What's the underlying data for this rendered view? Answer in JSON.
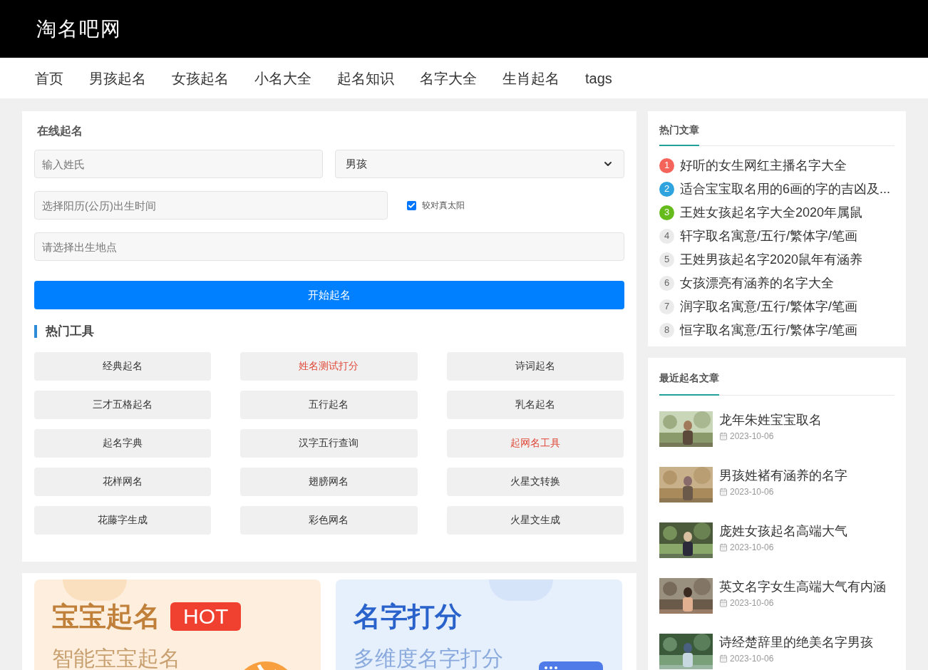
{
  "site": {
    "logo": "淘名吧网"
  },
  "nav": [
    {
      "label": "首页"
    },
    {
      "label": "男孩起名"
    },
    {
      "label": "女孩起名"
    },
    {
      "label": "小名大全"
    },
    {
      "label": "起名知识"
    },
    {
      "label": "名字大全"
    },
    {
      "label": "生肖起名"
    },
    {
      "label": "tags"
    }
  ],
  "form": {
    "title": "在线起名",
    "surname": {
      "placeholder": "输入姓氏"
    },
    "gender": {
      "value": "男孩"
    },
    "birth_time": {
      "placeholder": "选择阳历(公历)出生时间"
    },
    "true_solar": {
      "label": "较对真太阳",
      "checked": true
    },
    "birth_place": {
      "placeholder": "请选择出生地点"
    },
    "submit": "开始起名"
  },
  "tools": {
    "title": "热门工具",
    "items": [
      {
        "label": "经典起名",
        "hot": false
      },
      {
        "label": "姓名测试打分",
        "hot": true
      },
      {
        "label": "诗词起名",
        "hot": false
      },
      {
        "label": "三才五格起名",
        "hot": false
      },
      {
        "label": "五行起名",
        "hot": false
      },
      {
        "label": "乳名起名",
        "hot": false
      },
      {
        "label": "起名字典",
        "hot": false
      },
      {
        "label": "汉字五行查询",
        "hot": false
      },
      {
        "label": "起网名工具",
        "hot": true
      },
      {
        "label": "花样网名",
        "hot": false
      },
      {
        "label": "翅膀网名",
        "hot": false
      },
      {
        "label": "火星文转换",
        "hot": false
      },
      {
        "label": "花藤字生成",
        "hot": false
      },
      {
        "label": "彩色网名",
        "hot": false
      },
      {
        "label": "火星文生成",
        "hot": false
      }
    ]
  },
  "banners": [
    {
      "kind": "baby",
      "title": "宝宝起名",
      "badge": "HOT",
      "subtitle": "智能宝宝起名"
    },
    {
      "kind": "score",
      "title": "名字打分",
      "subtitle": "多维度名字打分"
    }
  ],
  "hot_articles": {
    "title": "热门文章",
    "items": [
      {
        "rank": "1",
        "title": "好听的女生网红主播名字大全",
        "color": "#f5645a"
      },
      {
        "rank": "2",
        "title": "适合宝宝取名用的6画的字的吉凶及...",
        "color": "#2ea3de"
      },
      {
        "rank": "3",
        "title": "王姓女孩起名字大全2020年属鼠",
        "color": "#65bb1b"
      },
      {
        "rank": "4",
        "title": "轩字取名寓意/五行/繁体字/笔画",
        "color": "#ebebeb"
      },
      {
        "rank": "5",
        "title": "王姓男孩起名字2020鼠年有涵养",
        "color": "#ebebeb"
      },
      {
        "rank": "6",
        "title": "女孩漂亮有涵养的名字大全",
        "color": "#ebebeb"
      },
      {
        "rank": "7",
        "title": "润字取名寓意/五行/繁体字/笔画",
        "color": "#ebebeb"
      },
      {
        "rank": "8",
        "title": "恒字取名寓意/五行/繁体字/笔画",
        "color": "#ebebeb"
      }
    ]
  },
  "recent_articles": {
    "title": "最近起名文章",
    "items": [
      {
        "title": "龙年朱姓宝宝取名",
        "date": "2023-10-06",
        "kind": "picture"
      },
      {
        "title": "男孩姓褚有涵养的名字",
        "date": "2023-10-06",
        "kind": "picture"
      },
      {
        "title": "庞姓女孩起名高端大气",
        "date": "2023-10-06",
        "kind": "picture"
      },
      {
        "title": "英文名字女生高端大气有内涵",
        "date": "2023-10-06",
        "kind": "picture"
      },
      {
        "title": "诗经楚辞里的绝美名字男孩",
        "date": "2023-10-06",
        "kind": "picture"
      }
    ]
  }
}
